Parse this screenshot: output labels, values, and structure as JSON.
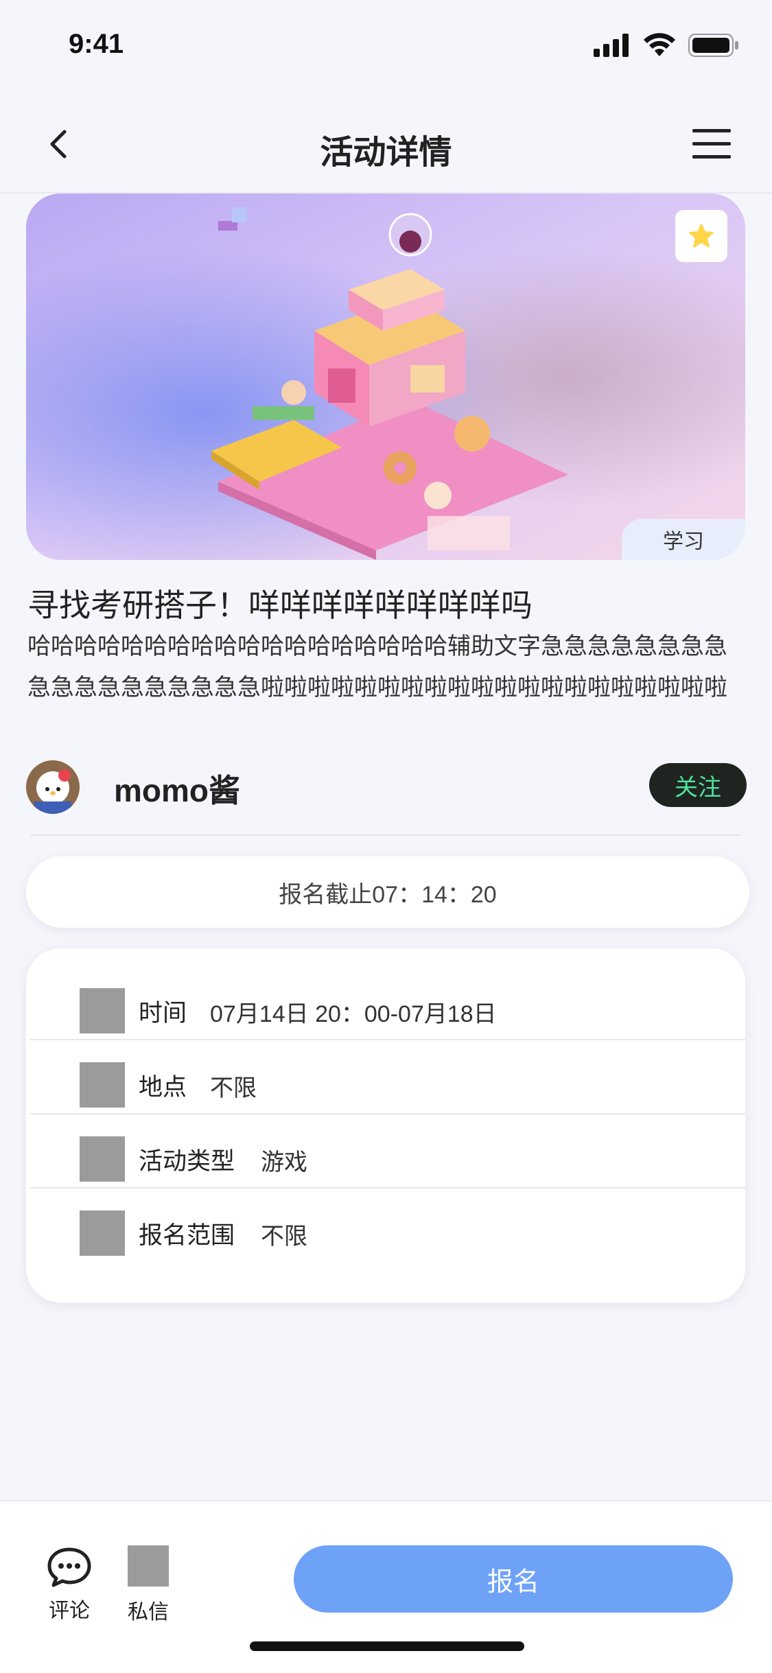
{
  "status_bar": {
    "time": "9:41"
  },
  "nav": {
    "title": "活动详情"
  },
  "hero": {
    "category_tag": "学习",
    "favorite_color": "#ffd54a"
  },
  "activity": {
    "title": "寻找考研搭子！咩咩咩咩咩咩咩咩吗",
    "description": "哈哈哈哈哈哈哈哈哈哈哈哈哈哈哈哈哈哈辅助文字急急急急急急急急急急急急急急急急急急啦啦啦啦啦啦啦啦啦啦啦啦啦啦啦啦啦啦啦啦"
  },
  "user": {
    "name": "momo酱",
    "follow_label": "关注"
  },
  "deadline": {
    "text": "报名截止07：14：20"
  },
  "info": {
    "rows": [
      {
        "label": "时间",
        "value": "07月14日  20：00-07月18日"
      },
      {
        "label": "地点",
        "value": "不限"
      },
      {
        "label": "活动类型",
        "value": "游戏"
      },
      {
        "label": "报名范围",
        "value": "不限"
      }
    ]
  },
  "bottom_bar": {
    "comment_label": "评论",
    "dm_label": "私信",
    "signup_label": "报名"
  },
  "colors": {
    "accent": "#6ea2f7",
    "follow_text": "#4fe29a",
    "background": "#f5f6fb"
  }
}
